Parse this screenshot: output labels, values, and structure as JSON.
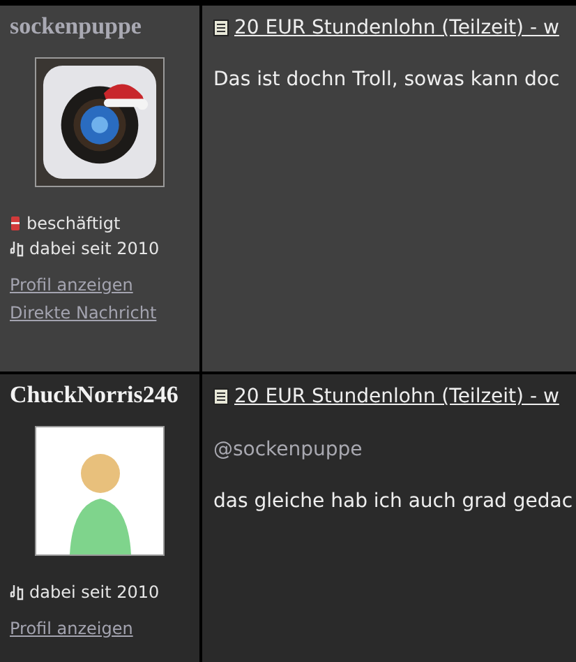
{
  "posts": [
    {
      "highlighted": true,
      "author": {
        "name": "sockenpuppe",
        "color": "#a9a9b3",
        "avatar": {
          "kind": "camera"
        }
      },
      "stats": [
        {
          "kind": "status",
          "text": "beschäftigt"
        },
        {
          "kind": "member",
          "text": "dabei seit 2010"
        }
      ],
      "links": [
        "Profil anzeigen",
        "Direkte Nachricht"
      ],
      "title": "20 EUR Stundenlohn (Teilzeit) - w",
      "body": "Das ist dochn Troll, sowas kann doc"
    },
    {
      "highlighted": false,
      "author": {
        "name": "ChuckNorris246",
        "color": "#f2f2f2",
        "avatar": {
          "kind": "cartoon"
        }
      },
      "stats": [
        {
          "kind": "member",
          "text": "dabei seit 2010"
        }
      ],
      "links": [
        "Profil anzeigen"
      ],
      "title": "20 EUR Stundenlohn (Teilzeit) - w",
      "mention": "@sockenpuppe",
      "body": "das gleiche hab ich auch grad gedac"
    }
  ]
}
